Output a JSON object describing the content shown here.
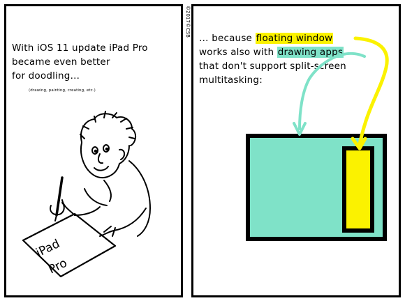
{
  "copyright": "©2017©CSB",
  "left_panel": {
    "caption_lines": [
      "With iOS 11 update iPad Pro",
      "became even better",
      "for doodling…"
    ],
    "note": "(drawing, painting, creating, etc.)",
    "ipad_word": "iPad",
    "pro_word": "Pro"
  },
  "right_panel": {
    "caption_part1": "… because ",
    "caption_highlight_yellow": "floating window",
    "caption_part2": "works also with ",
    "caption_highlight_teal": "drawing apps",
    "caption_part3": "that don't support split-screen",
    "caption_part4": "multitasking:"
  },
  "colors": {
    "yellow": "#fbf200",
    "teal": "#7fe2c8",
    "ink": "#000000"
  }
}
